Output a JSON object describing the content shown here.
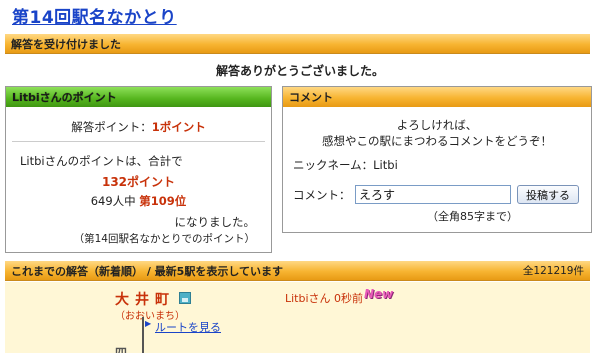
{
  "title": "第14回駅名なかとり",
  "accept_bar": "解答を受け付けました",
  "thanks": "解答ありがとうございました。",
  "points": {
    "header": "Litbiさんのポイント",
    "earned_label": "解答ポイント：",
    "earned_value": "1ポイント",
    "total_label": "Litbiさんのポイントは、合計で",
    "total_value": "132ポイント",
    "rank_prefix": "649人中 ",
    "rank_value": "第109位",
    "became": "になりました。",
    "note": "（第14回駅名なかとりでのポイント）"
  },
  "comment": {
    "header": "コメント",
    "msg1": "よろしければ、",
    "msg2": "感想やこの駅にまつわるコメントをどうぞ！",
    "nickname": "ニックネーム：Litbi",
    "label": "コメント：",
    "input_value": "えろす",
    "submit": "投稿する",
    "limit": "（全角85字まで）"
  },
  "history": {
    "header": "これまでの解答（新着順） / 最新5駅を表示しています",
    "count": "全121219件",
    "entry": {
      "station": "大井町",
      "reading": "（おおいまち）",
      "route_link": "ルートを見る",
      "user": "Litbiさん 0秒前",
      "badge": "New",
      "icon": "station-map-icon"
    },
    "next_station": "四 ..."
  },
  "colors": {
    "accent_blue": "#1a44c8",
    "accent_red": "#c8320a",
    "bar_orange": "#f7b431",
    "panel_green": "#55b51e",
    "history_bg": "#fff7d6"
  }
}
